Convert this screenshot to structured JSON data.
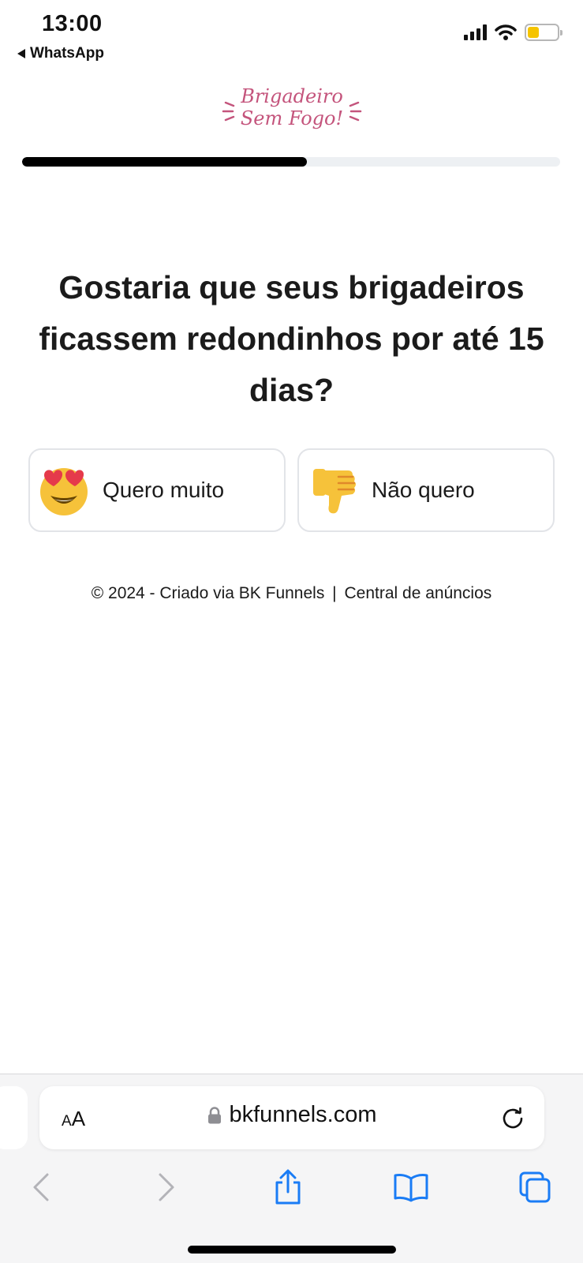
{
  "status_bar": {
    "time": "13:00",
    "back_app": "WhatsApp",
    "battery_color": "#f5c400"
  },
  "logo": {
    "line1": "Brigadeiro",
    "line2": "Sem Fogo!",
    "color": "#c4547c"
  },
  "progress": {
    "fraction": 0.53
  },
  "question": {
    "text": "Gostaria que seus brigadeiros ficassem redondinhos por até 15 dias?"
  },
  "options": [
    {
      "icon": "heart-eyes-emoji-icon",
      "label": "Quero muito"
    },
    {
      "icon": "thumbs-down-emoji-icon",
      "label": "Não quero"
    }
  ],
  "footer": {
    "credit": "© 2024 - Criado via BK Funnels",
    "separator": "|",
    "link": "Central de anúncios"
  },
  "browser": {
    "text_size_label": "AA",
    "url": "bkfunnels.com",
    "icons": [
      "back-icon",
      "forward-icon",
      "share-icon",
      "bookmarks-icon",
      "tabs-icon",
      "reload-icon",
      "lock-icon"
    ]
  }
}
